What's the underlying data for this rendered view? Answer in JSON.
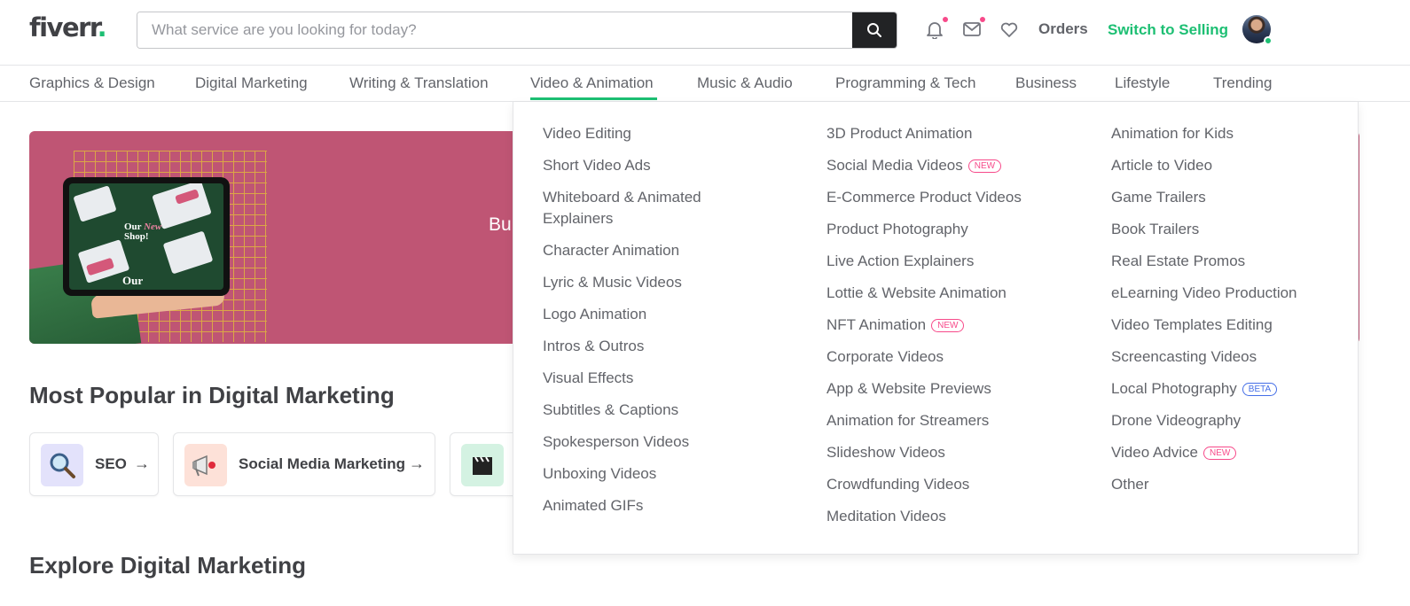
{
  "header": {
    "logo_text": "fiverr",
    "logo_dot": ".",
    "search_placeholder": "What service are you looking for today?",
    "orders": "Orders",
    "switch_to_selling": "Switch to Selling",
    "notification_badge_color": "#f74a8a",
    "brand_color": "#1dbf73"
  },
  "categories": [
    "Graphics & Design",
    "Digital Marketing",
    "Writing & Translation",
    "Video & Animation",
    "Music & Audio",
    "Programming & Tech",
    "Business",
    "Lifestyle",
    "Trending"
  ],
  "active_category": "Video & Animation",
  "banner": {
    "text_fragment": "Bu",
    "tablet_text_1": "Our",
    "tablet_text_2": "New",
    "tablet_text_3": "Shop!",
    "tablet_text_4": "Our"
  },
  "sections": {
    "popular_title": "Most Popular in Digital Marketing",
    "explore_title": "Explore Digital Marketing"
  },
  "popular_items": [
    {
      "label": "SEO",
      "icon": "magnifier-icon"
    },
    {
      "label": "Social Media Marketing",
      "icon": "megaphone-icon"
    },
    {
      "label": "",
      "icon": "clapperboard-icon"
    }
  ],
  "dropdown": {
    "col1": [
      {
        "label": "Video Editing"
      },
      {
        "label": "Short Video Ads"
      },
      {
        "label": "Whiteboard & Animated Explainers"
      },
      {
        "label": "Character Animation"
      },
      {
        "label": "Lyric & Music Videos"
      },
      {
        "label": "Logo Animation"
      },
      {
        "label": "Intros & Outros"
      },
      {
        "label": "Visual Effects"
      },
      {
        "label": "Subtitles & Captions"
      },
      {
        "label": "Spokesperson Videos"
      },
      {
        "label": "Unboxing Videos"
      },
      {
        "label": "Animated GIFs"
      }
    ],
    "col2": [
      {
        "label": "3D Product Animation"
      },
      {
        "label": "Social Media Videos",
        "tag": "NEW"
      },
      {
        "label": "E-Commerce Product Videos"
      },
      {
        "label": "Product Photography"
      },
      {
        "label": "Live Action Explainers"
      },
      {
        "label": "Lottie & Website Animation"
      },
      {
        "label": "NFT Animation",
        "tag": "NEW"
      },
      {
        "label": "Corporate Videos"
      },
      {
        "label": "App & Website Previews"
      },
      {
        "label": "Animation for Streamers"
      },
      {
        "label": "Slideshow Videos"
      },
      {
        "label": "Crowdfunding Videos"
      },
      {
        "label": "Meditation Videos"
      }
    ],
    "col3": [
      {
        "label": "Animation for Kids"
      },
      {
        "label": "Article to Video"
      },
      {
        "label": "Game Trailers"
      },
      {
        "label": "Book Trailers"
      },
      {
        "label": "Real Estate Promos"
      },
      {
        "label": "eLearning Video Production"
      },
      {
        "label": "Video Templates Editing"
      },
      {
        "label": "Screencasting Videos"
      },
      {
        "label": "Local Photography",
        "tag": "BETA"
      },
      {
        "label": "Drone Videography"
      },
      {
        "label": "Video Advice",
        "tag": "NEW"
      },
      {
        "label": "Other"
      }
    ]
  }
}
